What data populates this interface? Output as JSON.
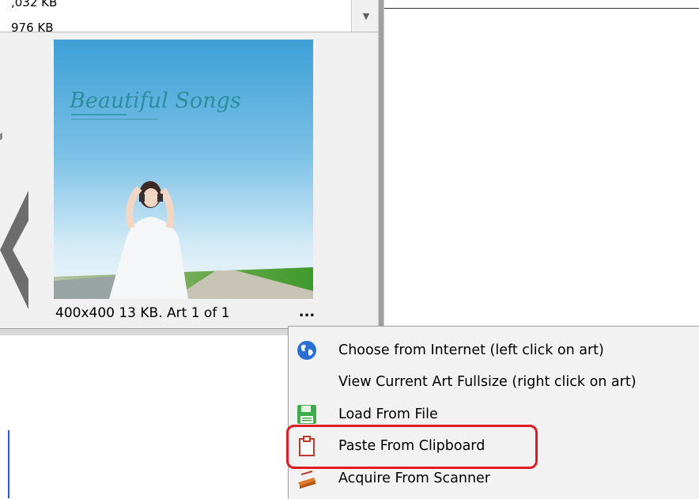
{
  "listbox": {
    "row1": ",032 KB",
    "row2": "976 KB"
  },
  "art": {
    "title": "Beautiful Songs",
    "caption": "400x400 13 KB. Art 1 of 1",
    "more_button": "..."
  },
  "context_menu": {
    "items": [
      {
        "label": "Choose from Internet (left click on art)",
        "icon": "globe-icon"
      },
      {
        "label": "View Current Art Fullsize (right click on art)",
        "icon": ""
      },
      {
        "label": "Load From File",
        "icon": "floppy-disk-icon"
      },
      {
        "label": "Paste From Clipboard",
        "icon": "clipboard-icon"
      },
      {
        "label": "Acquire From Scanner",
        "icon": "scanner-icon"
      }
    ],
    "highlighted_item": "Paste From Clipboard"
  },
  "colors": {
    "highlight_border": "#e01b24",
    "menu_background": "#f2f2f2"
  }
}
